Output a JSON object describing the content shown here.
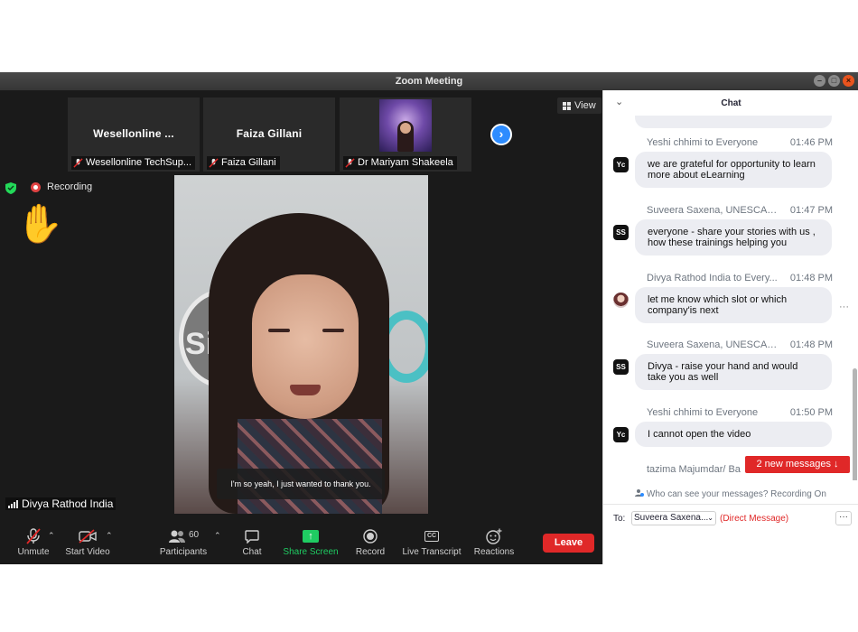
{
  "window": {
    "title": "Zoom Meeting",
    "controls": [
      "–",
      "□",
      "×"
    ]
  },
  "thumbnails": [
    {
      "display_name": "Wesellonline ...",
      "label": "Wesellonline TechSup...",
      "has_photo": false
    },
    {
      "display_name": "Faiza Gillani",
      "label": "Faiza Gillani",
      "has_photo": false
    },
    {
      "display_name": "",
      "label": "Dr Mariyam Shakeela",
      "has_photo": true
    }
  ],
  "view_button": {
    "label": "View"
  },
  "stage": {
    "recording_label": "Recording",
    "raise_hand": "✋",
    "caption": "I'm so yeah, I just wanted to thank you.",
    "active_speaker": "Divya Rathod India",
    "logo_text": "Si"
  },
  "toolbar": {
    "unmute": "Unmute",
    "start_video": "Start Video",
    "participants": "Participants",
    "participants_count": "60",
    "chat": "Chat",
    "share_screen": "Share Screen",
    "record": "Record",
    "live_transcript": "Live Transcript",
    "reactions": "Reactions",
    "leave": "Leave",
    "cc": "CC"
  },
  "chat": {
    "title": "Chat",
    "messages": [
      {
        "from": "Yeshi chhimi to Everyone",
        "time": "01:46 PM",
        "avatar": "Yc",
        "text": "we are grateful for opportunity to learn more about eLearning"
      },
      {
        "from": "Suveera Saxena, UNESCAP to Everyone",
        "time": "01:47 PM",
        "avatar": "SS",
        "text": "everyone - share your stories with us , how these trainings helping you"
      },
      {
        "from": "Divya Rathod India to Every...",
        "time": "01:48 PM",
        "avatar": "",
        "text": "let me know which slot or which company'is next"
      },
      {
        "from": "Suveera Saxena, UNESCAP t...",
        "time": "01:48 PM",
        "avatar": "SS",
        "text": "Divya - raise your hand and would take you as well"
      },
      {
        "from": "Yeshi chhimi to Everyone",
        "time": "01:50 PM",
        "avatar": "Yc",
        "text": "I cannot open the video"
      },
      {
        "from": "tazima Majumdar/ Ba",
        "time": "",
        "avatar": "",
        "text": ""
      }
    ],
    "new_messages": "2 new messages ↓",
    "who_can_see": "Who can see your messages? Recording On",
    "to_label": "To:",
    "to_value": "Suveera Saxena...",
    "direct_message": "(Direct Message)",
    "more": "···"
  },
  "colors": {
    "accent": "#2d8cff",
    "share_green": "#1fcc62",
    "leave_red": "#e02828"
  }
}
